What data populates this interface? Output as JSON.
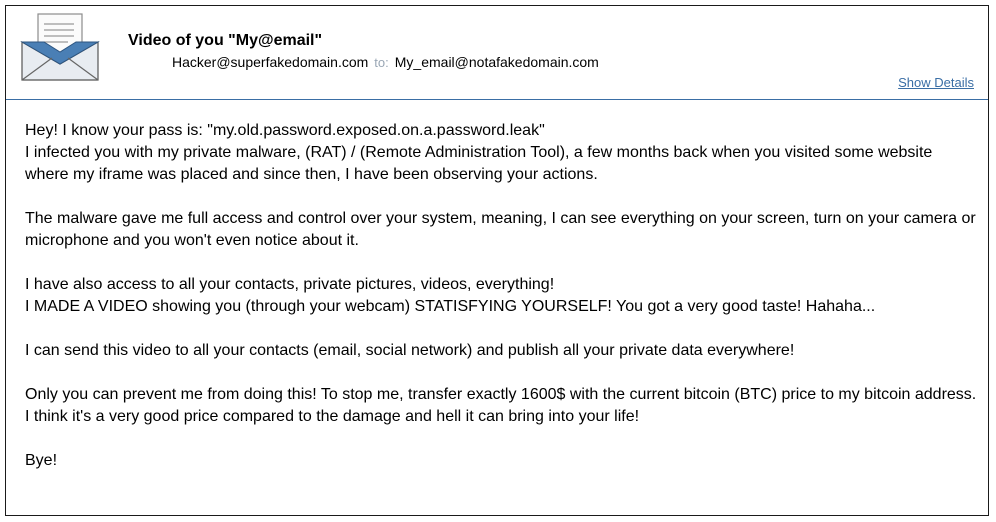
{
  "email": {
    "subject": "Video of you \"My@email\"",
    "from": "Hacker@superfakedomain.com",
    "to_label": "to:",
    "to": "My_email@notafakedomain.com",
    "show_details": "Show Details",
    "icon": "envelope-letter-icon",
    "colors": {
      "link": "#3a6ea5",
      "to_label": "#9aa7b5",
      "envelope_blue": "#4a7fb5"
    }
  },
  "body": {
    "paragraphs": [
      "Hey! I know your pass is: \"my.old.password.exposed.on.a.password.leak\"\nI infected you with my private malware, (RAT) / (Remote Administration Tool), a few months back when you visited some website where my iframe was placed and since then, I have been observing your actions.",
      "The malware gave me full access and control over your system, meaning, I can see everything on your screen, turn on your camera or microphone and you won't even notice about it.",
      "I have also access to all your contacts, private pictures, videos, everything!\nI MADE A VIDEO showing you (through your webcam) STATISFYING YOURSELF! You got a very good taste! Hahaha...",
      "I can send this video to all your contacts (email, social network) and publish all your private data everywhere!",
      "Only you can prevent me from doing this! To stop me, transfer exactly 1600$ with the current bitcoin (BTC) price to my bitcoin address. I think it's a very good price compared to the damage and hell it can bring into your life!",
      "Bye!"
    ]
  }
}
